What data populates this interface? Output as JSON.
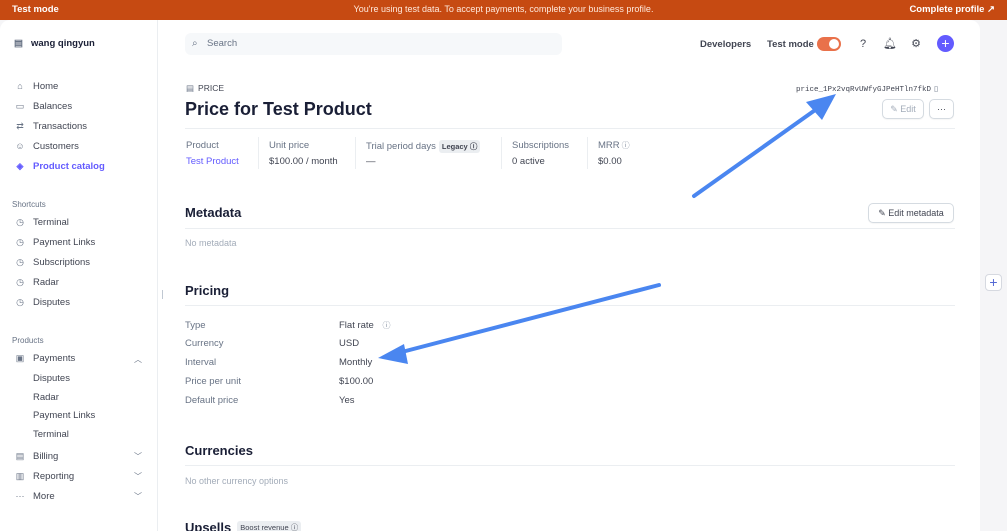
{
  "banner": {
    "mode": "Test mode",
    "message": "You're using test data. To accept payments, complete your business profile.",
    "complete": "Complete profile",
    "complete_icon": "↗"
  },
  "sidebar": {
    "account": "wang qingyun",
    "nav": [
      {
        "label": "Home",
        "icon": "home-icon"
      },
      {
        "label": "Balances",
        "icon": "balances-icon"
      },
      {
        "label": "Transactions",
        "icon": "transactions-icon"
      },
      {
        "label": "Customers",
        "icon": "customers-icon"
      },
      {
        "label": "Product catalog",
        "icon": "product-catalog-icon",
        "active": true
      }
    ],
    "shortcuts_heading": "Shortcuts",
    "shortcuts": [
      "Terminal",
      "Payment Links",
      "Subscriptions",
      "Radar",
      "Disputes"
    ],
    "products_heading": "Products",
    "payments": "Payments",
    "payments_sub": [
      "Disputes",
      "Radar",
      "Payment Links",
      "Terminal"
    ],
    "billing": "Billing",
    "reporting": "Reporting",
    "more": "More"
  },
  "header": {
    "search_placeholder": "Search",
    "developers": "Developers",
    "test_mode": "Test mode",
    "test_mode_on": true
  },
  "page": {
    "tag": "PRICE",
    "title": "Price for Test Product",
    "price_id": "price_1Px2vqRvUWfyGJPeHTln7fkD",
    "edit": "Edit",
    "more": "···"
  },
  "summary": {
    "product_label": "Product",
    "product_value": "Test Product",
    "unit_price_label": "Unit price",
    "unit_price_value": "$100.00 / month",
    "trial_label": "Trial period days",
    "trial_badge": "Legacy",
    "trial_value": "—",
    "subs_label": "Subscriptions",
    "subs_value": "0 active",
    "mrr_label": "MRR",
    "mrr_value": "$0.00"
  },
  "metadata": {
    "title": "Metadata",
    "edit": "Edit metadata",
    "empty": "No metadata"
  },
  "pricing": {
    "title": "Pricing",
    "rows": [
      {
        "label": "Type",
        "value": "Flat rate"
      },
      {
        "label": "Currency",
        "value": "USD"
      },
      {
        "label": "Interval",
        "value": "Monthly"
      },
      {
        "label": "Price per unit",
        "value": "$100.00"
      },
      {
        "label": "Default price",
        "value": "Yes"
      }
    ]
  },
  "currencies": {
    "title": "Currencies",
    "empty": "No other currency options"
  },
  "upsells": {
    "title": "Upsells",
    "badge": "Boost revenue"
  },
  "colors": {
    "banner": "#c64a12",
    "accent": "#635bff",
    "arrow": "#4a86f0"
  }
}
